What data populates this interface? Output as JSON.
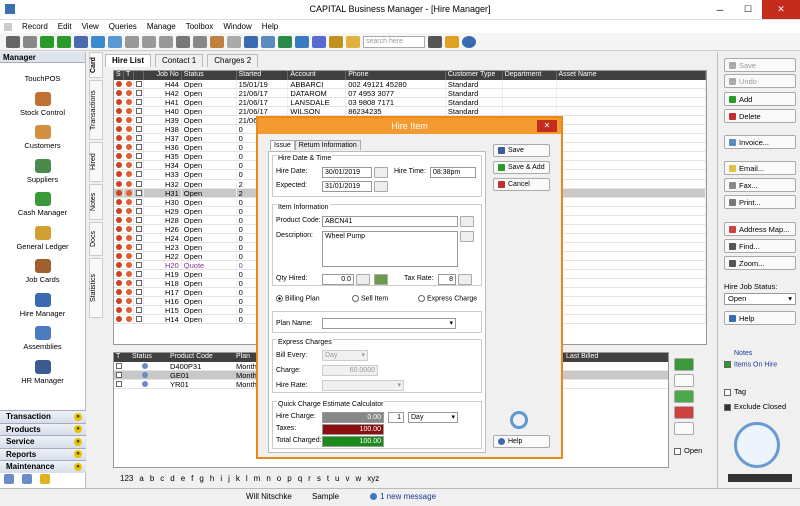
{
  "window": {
    "title": "CAPITAL Business Manager - [Hire Manager]"
  },
  "menu": [
    "Record",
    "Edit",
    "View",
    "Queries",
    "Manage",
    "Toolbox",
    "Window",
    "Help"
  ],
  "toolbar": {
    "search_placeholder": "search here"
  },
  "left_panel": {
    "header": "Manager",
    "items": [
      "TouchPOS",
      "Stock Control",
      "Customers",
      "Suppliers",
      "Cash Manager",
      "General Ledger",
      "Job Cards",
      "Hire Manager",
      "Assemblies",
      "HR Manager"
    ],
    "sections": [
      "Transaction",
      "Products",
      "Service",
      "Reports",
      "Maintenance"
    ]
  },
  "vertical_tabs": [
    "Card",
    "Transactions",
    "Hired",
    "Notes",
    "Docs",
    "Statistics"
  ],
  "tabs": {
    "hire_list": "Hire List",
    "contact": "Contact 1",
    "charges": "Charges 2"
  },
  "grid": {
    "headers": [
      "S",
      "T",
      "",
      "Job No",
      "Status",
      "Started",
      "Account",
      "Phone",
      "Customer Type",
      "Department",
      "Asset Name"
    ],
    "rows": [
      [
        "H44",
        "Open",
        "15/01/19",
        "ABBARCI",
        "002 49121 45280",
        "Standard"
      ],
      [
        "H42",
        "Open",
        "21/06/17",
        "DATAROM",
        "07 4953 3077",
        "Standard"
      ],
      [
        "H41",
        "Open",
        "21/06/17",
        "LANSDALE",
        "03 9808 7171",
        "Standard"
      ],
      [
        "H40",
        "Open",
        "21/06/17",
        "WILSON",
        "86234235",
        "Standard"
      ],
      [
        "H39",
        "Open",
        "21/06/17",
        "",
        "",
        ""
      ],
      [
        "H38",
        "Open",
        "0",
        "",
        "",
        ""
      ],
      [
        "H37",
        "Open",
        "0",
        "",
        "",
        ""
      ],
      [
        "H36",
        "Open",
        "0",
        "",
        "",
        ""
      ],
      [
        "H35",
        "Open",
        "0",
        "",
        "",
        ""
      ],
      [
        "H34",
        "Open",
        "0",
        "",
        "",
        ""
      ],
      [
        "H33",
        "Open",
        "0",
        "",
        "",
        ""
      ],
      [
        "H32",
        "Open",
        "2",
        "",
        "",
        ""
      ],
      [
        "H31",
        "Open",
        "2",
        "",
        "",
        ""
      ],
      [
        "H30",
        "Open",
        "0",
        "",
        "",
        ""
      ],
      [
        "H29",
        "Open",
        "0",
        "",
        "",
        ""
      ],
      [
        "H28",
        "Open",
        "0",
        "",
        "",
        ""
      ],
      [
        "H26",
        "Open",
        "0",
        "",
        "",
        ""
      ],
      [
        "H24",
        "Open",
        "0",
        "",
        "",
        ""
      ],
      [
        "H23",
        "Open",
        "0",
        "",
        "",
        ""
      ],
      [
        "H22",
        "Open",
        "0",
        "",
        "",
        ""
      ],
      [
        "H20",
        "Quote",
        "0",
        "",
        "",
        ""
      ],
      [
        "H19",
        "Open",
        "0",
        "",
        "",
        ""
      ],
      [
        "H18",
        "Open",
        "0",
        "",
        "",
        ""
      ],
      [
        "H17",
        "Open",
        "0",
        "",
        "",
        ""
      ],
      [
        "H16",
        "Open",
        "0",
        "",
        "",
        ""
      ],
      [
        "H15",
        "Open",
        "0",
        "",
        "",
        ""
      ],
      [
        "H14",
        "Open",
        "0",
        "",
        "",
        ""
      ]
    ]
  },
  "subgrid": {
    "headers": [
      "T",
      "Status",
      "Product Code",
      "Plan",
      "Last Billed"
    ],
    "rows": [
      [
        "D400P31",
        "Monthl"
      ],
      [
        "GE01",
        "Monthl"
      ],
      [
        "YR01",
        "Monthl"
      ]
    ]
  },
  "right_panel": {
    "save": "Save",
    "undo": "Undo",
    "add": "Add",
    "delete": "Delete",
    "invoice": "Invoice...",
    "email": "Email...",
    "fax": "Fax...",
    "print": "Print...",
    "address_map": "Address Map...",
    "find": "Find...",
    "zoom": "Zoom...",
    "hire_job_status_label": "Hire Job Status:",
    "hire_job_status_value": "Open",
    "help": "Help",
    "notes_label": "Notes",
    "items_on_hire": "Items On Hire",
    "tag": "Tag",
    "exclude_closed": "Exclude Closed"
  },
  "side_open": "Open",
  "alphabet": [
    "123",
    "a",
    "b",
    "c",
    "d",
    "e",
    "f",
    "g",
    "h",
    "i",
    "j",
    "k",
    "l",
    "m",
    "n",
    "o",
    "p",
    "q",
    "r",
    "s",
    "t",
    "u",
    "v",
    "w",
    "xyz"
  ],
  "status_bar": {
    "user": "Will Nitschke",
    "company": "Sample",
    "message": "1 new message"
  },
  "dialog": {
    "title": "Hire Item",
    "tabs": [
      "Issue",
      "Return Information"
    ],
    "hire_date_time": "Hire Date & Time",
    "hire_date_label": "Hire Date:",
    "hire_date": "30/01/2019",
    "hire_time_label": "Hire Time:",
    "hire_time": "08:38pm",
    "expected_label": "Expected:",
    "expected": "31/01/2019",
    "item_info": "Item Information",
    "product_code_label": "Product Code:",
    "product_code": "ABCN41",
    "description_label": "Description:",
    "description": "Wheel Pump",
    "qty_label": "Qty Hired:",
    "qty": "0.0",
    "tax_rate_label": "Tax Rate:",
    "tax_rate": "8",
    "billing_plan": "Billing Plan",
    "sell_item": "Sell Item",
    "express_charge": "Express Charge",
    "plan_name_label": "Plan Name:",
    "express_charges": "Express Charges",
    "bill_every_label": "Bill Every:",
    "bill_every": "Day",
    "charge_label": "Charge:",
    "charge": "60.0000",
    "hire_rate_label": "Hire Rate:",
    "quick_charge": "Quick Charge Estimate Calculator",
    "hire_charge_label": "Hire Charge:",
    "hire_charge": "0.00",
    "qty_units": "1",
    "units": "Day",
    "taxes_label": "Taxes:",
    "taxes": "100.00",
    "total_label": "Total Charged:",
    "total": "100.00",
    "btn_save": "Save",
    "btn_save_add": "Save & Add",
    "btn_cancel": "Cancel",
    "btn_help": "Help"
  }
}
